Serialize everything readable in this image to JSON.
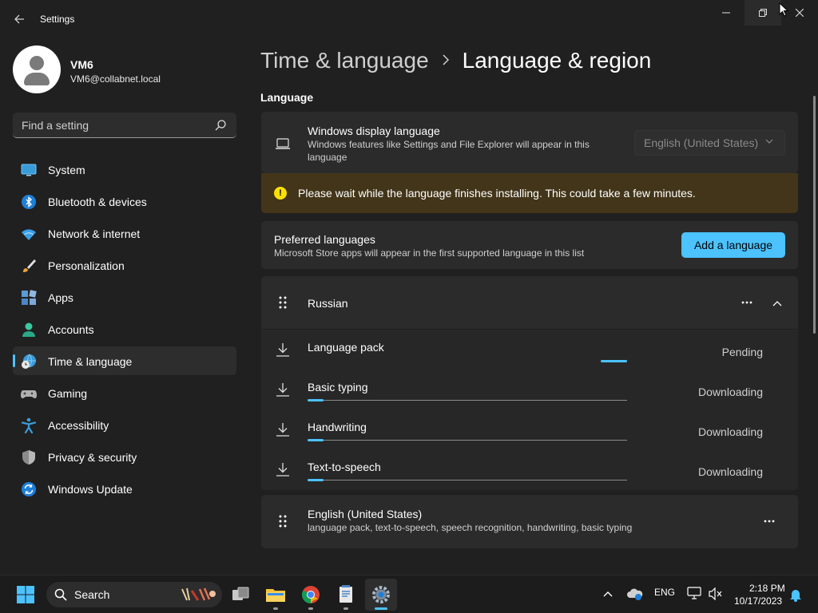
{
  "window": {
    "title": "Settings",
    "back_icon": "arrow-left-icon"
  },
  "profile": {
    "name": "VM6",
    "email": "VM6@collabnet.local"
  },
  "search": {
    "placeholder": "Find a setting"
  },
  "nav": {
    "items": [
      {
        "label": "System",
        "icon": "monitor-icon"
      },
      {
        "label": "Bluetooth & devices",
        "icon": "bluetooth-icon"
      },
      {
        "label": "Network & internet",
        "icon": "wifi-icon"
      },
      {
        "label": "Personalization",
        "icon": "brush-icon"
      },
      {
        "label": "Apps",
        "icon": "apps-icon"
      },
      {
        "label": "Accounts",
        "icon": "person-icon"
      },
      {
        "label": "Time & language",
        "icon": "globe-clock-icon",
        "active": true
      },
      {
        "label": "Gaming",
        "icon": "gamepad-icon"
      },
      {
        "label": "Accessibility",
        "icon": "accessibility-icon"
      },
      {
        "label": "Privacy & security",
        "icon": "shield-icon"
      },
      {
        "label": "Windows Update",
        "icon": "update-icon"
      }
    ]
  },
  "breadcrumb": {
    "parent": "Time & language",
    "current": "Language & region"
  },
  "language_section": {
    "title": "Language",
    "display_language": {
      "title": "Windows display language",
      "desc": "Windows features like Settings and File Explorer will appear in this language",
      "selected": "English (United States)"
    },
    "warning": "Please wait while the language finishes installing. This could take a few minutes.",
    "preferred": {
      "title": "Preferred languages",
      "desc": "Microsoft Store apps will appear in the first supported language in this list",
      "add_button": "Add a language"
    },
    "languages": [
      {
        "name": "Russian",
        "features": [
          {
            "label": "Language pack",
            "status": "Pending",
            "progress": null
          },
          {
            "label": "Basic typing",
            "status": "Downloading",
            "progress": 0.05
          },
          {
            "label": "Handwriting",
            "status": "Downloading",
            "progress": 0.05
          },
          {
            "label": "Text-to-speech",
            "status": "Downloading",
            "progress": 0.05
          }
        ]
      },
      {
        "name": "English (United States)",
        "desc": "language pack, text-to-speech, speech recognition, handwriting, basic typing"
      }
    ]
  },
  "taskbar": {
    "search_label": "Search",
    "apps": [
      "start-icon",
      "task-view-icon",
      "file-explorer-icon",
      "chrome-icon",
      "notepad-icon",
      "settings-icon"
    ],
    "tray": {
      "lang": "ENG",
      "time": "2:18 PM",
      "date": "10/17/2023"
    }
  },
  "colors": {
    "accent": "#4cc2ff",
    "warning_bg": "#433519",
    "warning_icon": "#fce100"
  }
}
